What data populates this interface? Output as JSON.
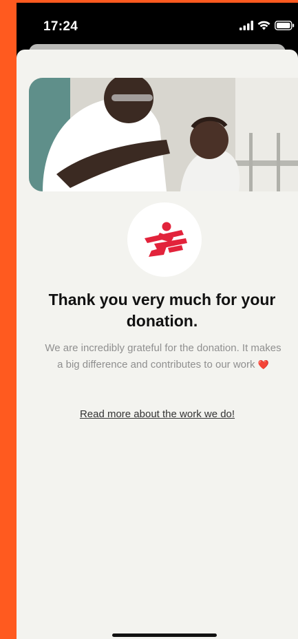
{
  "status_bar": {
    "time": "17:24",
    "icons": [
      "signal-icon",
      "wifi-icon",
      "battery-icon"
    ]
  },
  "hero": {
    "logo": "msf-logo"
  },
  "confirmation": {
    "title": "Thank you very much for your donation.",
    "body": "We are incredibly grateful for the donation. It makes a big difference and contributes to our work",
    "heart": "❤️",
    "link": "Read more about the work we do!"
  },
  "colors": {
    "accent": "#ff5a1f",
    "brand_red": "#e2233b",
    "sheet_bg": "#f3f3ef"
  }
}
